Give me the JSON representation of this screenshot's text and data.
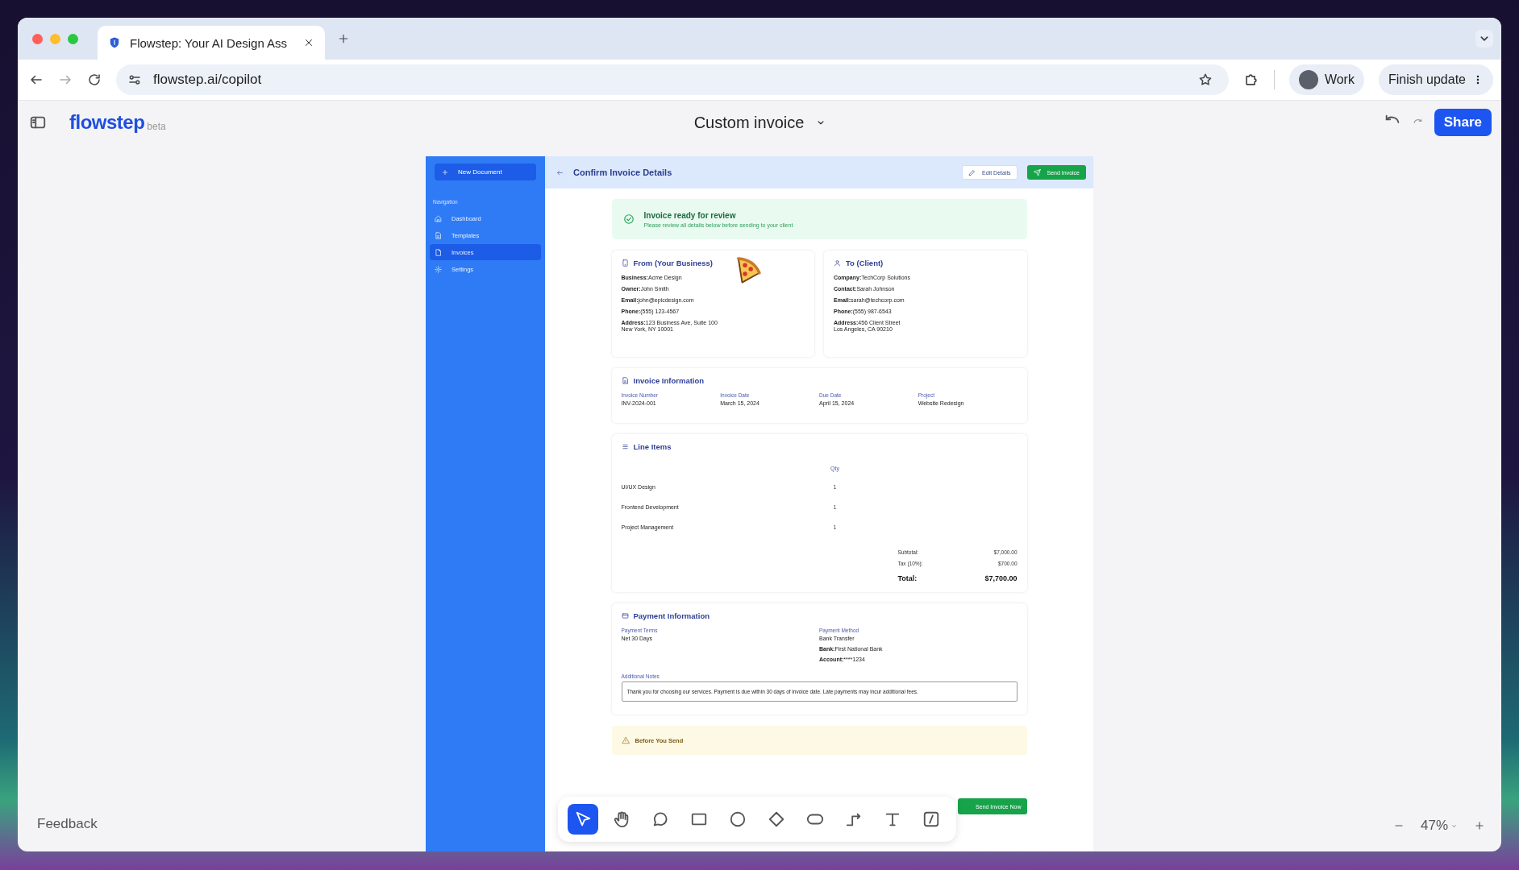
{
  "browser": {
    "tabs": [
      {
        "title": "Flowstep: Your AI Design Ass",
        "selected": true
      }
    ],
    "url": "flowstep.ai/copilot",
    "profile": "Work",
    "update_button": "Finish update"
  },
  "app": {
    "logo": "flowstep",
    "badge": "beta",
    "document_title": "Custom invoice",
    "share": "Share",
    "feedback": "Feedback",
    "zoom": "47%"
  },
  "tools": [
    {
      "kind": "select",
      "selected": true
    },
    {
      "kind": "hand",
      "selected": false
    },
    {
      "kind": "comment",
      "selected": false
    },
    {
      "kind": "rectangle",
      "selected": false
    },
    {
      "kind": "circle",
      "selected": false
    },
    {
      "kind": "diamond",
      "selected": false
    },
    {
      "kind": "pill",
      "selected": false
    },
    {
      "kind": "connector",
      "selected": false
    },
    {
      "kind": "text",
      "selected": false
    },
    {
      "kind": "slash",
      "selected": false
    }
  ],
  "design": {
    "sidebar": {
      "new_button": "New Document",
      "section": "Navigation",
      "items": [
        {
          "label": "Dashboard",
          "kind": "home",
          "selected": false
        },
        {
          "label": "Templates",
          "kind": "doc",
          "selected": false
        },
        {
          "label": "Invoices",
          "kind": "page",
          "selected": true
        },
        {
          "label": "Settings",
          "kind": "gear",
          "selected": false
        }
      ]
    },
    "header": {
      "title": "Confirm Invoice Details",
      "edit_button": "Edit Details",
      "send_button": "Send Invoice"
    },
    "banner": {
      "title": "Invoice ready for review",
      "text": "Please review all details below before sending to your client"
    },
    "parties": [
      {
        "kind": "tablet",
        "title": "From (Your Business)",
        "fields": [
          "**Business:**Acme Design",
          "**Owner:**John Smith",
          "**Email:**john@epicdesign.com",
          "**Phone:**(555) 123-4567",
          "**Address:**123 Business Ave, Suite 100"
        ],
        "address_line_2": "New York, NY 10001"
      },
      {
        "kind": "user",
        "title": "To (Client)",
        "fields": [
          "**Company:**TechCorp Solutions",
          "**Contact:**Sarah Johnson",
          "**Email:**sarah@techcorp.com",
          "**Phone:**(555) 987-6543",
          "**Address:**456 Client Street"
        ],
        "address_line_2": "Los Angeles, CA 90210"
      }
    ],
    "invoice_info": {
      "title": "Invoice Information",
      "items": [
        {
          "label": "Invoice Number",
          "value": "INV-2024-001"
        },
        {
          "label": "Invoice Date",
          "value": "March 15, 2024"
        },
        {
          "label": "Due Date",
          "value": "April 15, 2024"
        },
        {
          "label": "Project",
          "value": "Website Redesign"
        }
      ]
    },
    "line_items": {
      "title": "Line Items",
      "qty_header": "Qty",
      "rows": [
        {
          "name": "UI/UX Design",
          "qty": "1"
        },
        {
          "name": "Frontend Development",
          "qty": "1"
        },
        {
          "name": "Project Management",
          "qty": "1"
        }
      ],
      "totals": [
        {
          "label": "Subtotal:",
          "value": "$7,000.00",
          "kind": "sub"
        },
        {
          "label": "Tax (10%):",
          "value": "$700.00",
          "kind": "sub"
        },
        {
          "label": "Total:",
          "value": "$7,700.00",
          "kind": "total"
        }
      ]
    },
    "payment": {
      "title": "Payment Information",
      "terms_label": "Payment Terms",
      "terms": "Net 30 Days",
      "method_label": "Payment Method",
      "method": "Bank Transfer",
      "bank": {
        "label": "Bank:",
        "value": "First National Bank"
      },
      "account": {
        "label": "Account:",
        "value": "****1234"
      },
      "notes_label": "Additional Notes",
      "notes": "Thank you for choosing our services. Payment is due within 30 days of invoice date. Late payments may incur additional fees."
    },
    "warning": {
      "title": "Before You Send"
    },
    "final_button": "Send Invoice Now"
  }
}
